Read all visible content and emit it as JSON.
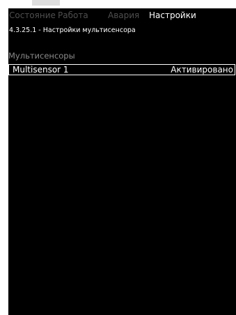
{
  "tabs": [
    {
      "label": "Состояние"
    },
    {
      "label": "Работа"
    },
    {
      "label": "Авария"
    },
    {
      "label": "Настройки"
    }
  ],
  "header": {
    "subtitle": "4.3.25.1 - Настройки мультисенсора"
  },
  "section": {
    "title": "Мультисенсоры"
  },
  "list": {
    "items": [
      {
        "name": "Multisensor 1",
        "status": "Активировано"
      }
    ]
  },
  "colors": {
    "background": "#000000",
    "inactive_tab": "#4f4f4f",
    "active_text": "#ffffff",
    "section_text": "#8b8b8b"
  }
}
